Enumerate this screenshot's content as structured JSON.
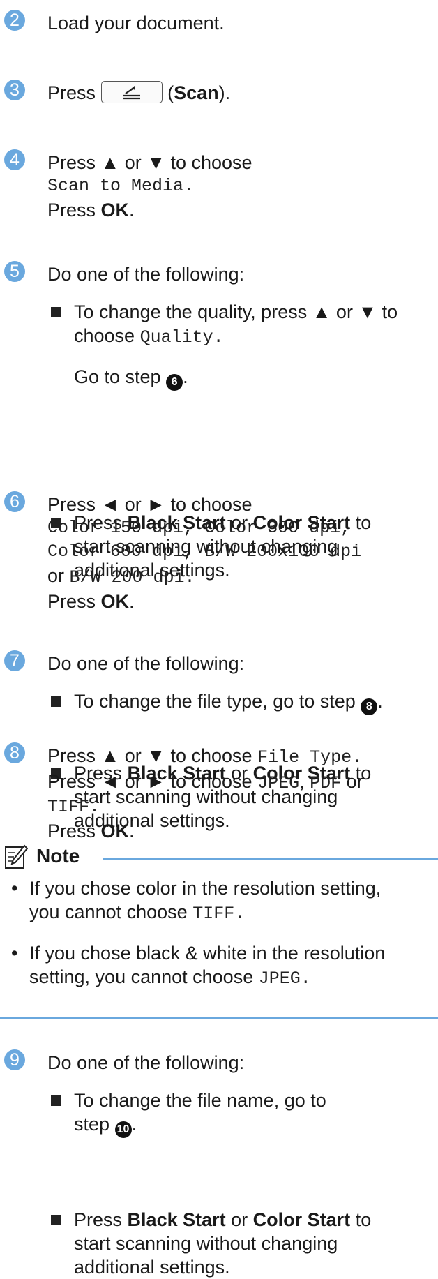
{
  "steps": {
    "s2": {
      "num": "2",
      "text": "Load your document."
    },
    "s3": {
      "num": "3",
      "press": "Press",
      "scan_open": "(",
      "scan_label": "Scan",
      "scan_close": ")."
    },
    "s4": {
      "num": "4",
      "line1": "Press ▲ or ▼ to choose",
      "mono": "Scan to Media.",
      "press": "Press",
      "ok": "OK",
      "dot": "."
    },
    "s5": {
      "num": "5",
      "intro": "Do one of the following:",
      "b1_line1": "To change the quality, press ▲ or ▼ to",
      "b1_choose": "choose",
      "b1_mono": "Quality.",
      "b1_goto": "Go to step",
      "b1_ref": "6",
      "b1_dot": ".",
      "b2_press": "Press",
      "b2_black": "Black Start",
      "b2_or": "or",
      "b2_color": "Color Start",
      "b2_to": "to",
      "b2_line2": "start scanning without changing",
      "b2_line3": "additional settings."
    },
    "s6": {
      "num": "6",
      "line1": "Press ◄ or ► to choose",
      "opt1": "Color 150 dpi,",
      "opt2": "Color 300 dpi,",
      "opt3": "Color 600 dpi,",
      "opt4": "B/W 200x100 dpi",
      "or": "or",
      "opt5": "B/W 200 dpi.",
      "press": "Press",
      "ok": "OK",
      "dot": "."
    },
    "s7": {
      "num": "7",
      "intro": "Do one of the following:",
      "b1": "To change the file type, go to step",
      "b1_ref": "8",
      "b1_dot": ".",
      "b2_press": "Press",
      "b2_black": "Black Start",
      "b2_or": "or",
      "b2_color": "Color Start",
      "b2_to": "to",
      "b2_line2": "start scanning without changing",
      "b2_line3": "additional settings."
    },
    "s8": {
      "num": "8",
      "l1_press": "Press ▲ or ▼ to choose",
      "l1_mono": "File Type.",
      "l2_press": "Press ◄ or ► to choose",
      "l2_jpeg": "JPEG",
      "l2_comma": ",",
      "l2_pdf": "PDF",
      "l2_or": "or",
      "l3_mono": "TIFF.",
      "press": "Press",
      "ok": "OK",
      "dot": "."
    },
    "s9": {
      "num": "9",
      "intro": "Do one of the following:",
      "b1_line1": "To change the file name, go to",
      "b1_step": "step",
      "b1_ref": "10",
      "b1_dot": ".",
      "b2_press": "Press",
      "b2_black": "Black Start",
      "b2_or": "or",
      "b2_color": "Color Start",
      "b2_to": "to",
      "b2_line2": "start scanning without changing",
      "b2_line3": "additional settings."
    }
  },
  "note": {
    "title": "Note",
    "i1_line1": "If you chose color in the resolution setting,",
    "i1_line2": "you cannot choose",
    "i1_mono": "TIFF.",
    "i2_line1": "If you chose black & white in the resolution",
    "i2_line2": "setting, you cannot choose",
    "i2_mono": "JPEG."
  },
  "colors": {
    "accent": "#6aa8de",
    "text": "#1a1a1a"
  },
  "icons": {
    "scan": "scan-key-icon",
    "note": "note-pencil-icon"
  }
}
